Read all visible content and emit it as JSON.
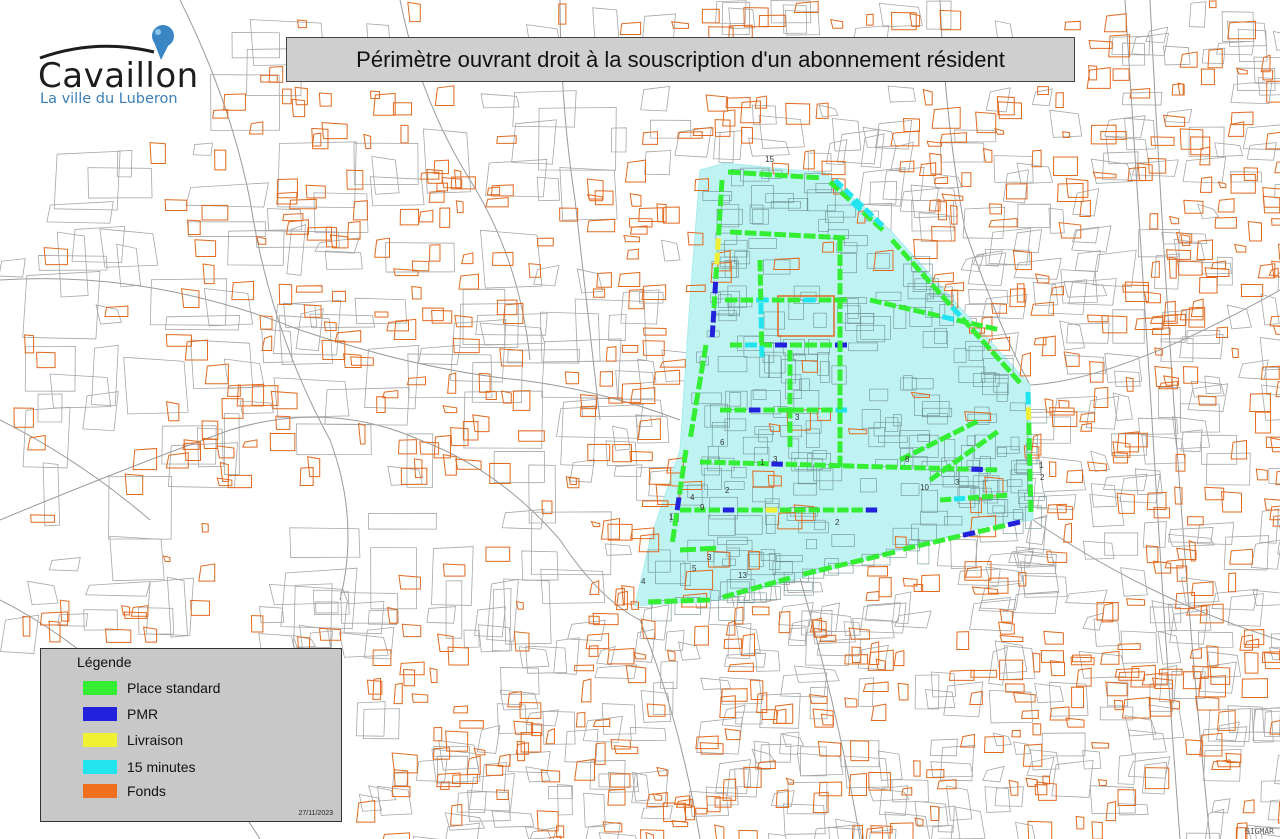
{
  "map": {
    "title": "Périmètre ouvrant droit à la souscription d'un abonnement résident",
    "date": "27/11/2023",
    "stamp": "SIGMAR"
  },
  "logo": {
    "name": "Cavaillon",
    "tagline": "La ville du Luberon",
    "icon": "map-pin-icon"
  },
  "legend": {
    "title": "Légende",
    "items": [
      {
        "label": "Place standard",
        "color": "#33ee33"
      },
      {
        "label": "PMR",
        "color": "#2222dd"
      },
      {
        "label": "Livraison",
        "color": "#f0f032"
      },
      {
        "label": "15 minutes",
        "color": "#22e4ee"
      },
      {
        "label": "Fonds",
        "color": "#f07020"
      }
    ]
  },
  "colors": {
    "perimeter_fill": "#bff3f3",
    "parcel_line": "#9a9a9a",
    "building": "#e06a20"
  },
  "space_counts": [
    "15",
    "3",
    "2",
    "1",
    "4",
    "5",
    "13",
    "9",
    "6",
    "8",
    "10",
    "2",
    "1",
    "3",
    "4",
    "1",
    "2",
    "3",
    "3"
  ]
}
